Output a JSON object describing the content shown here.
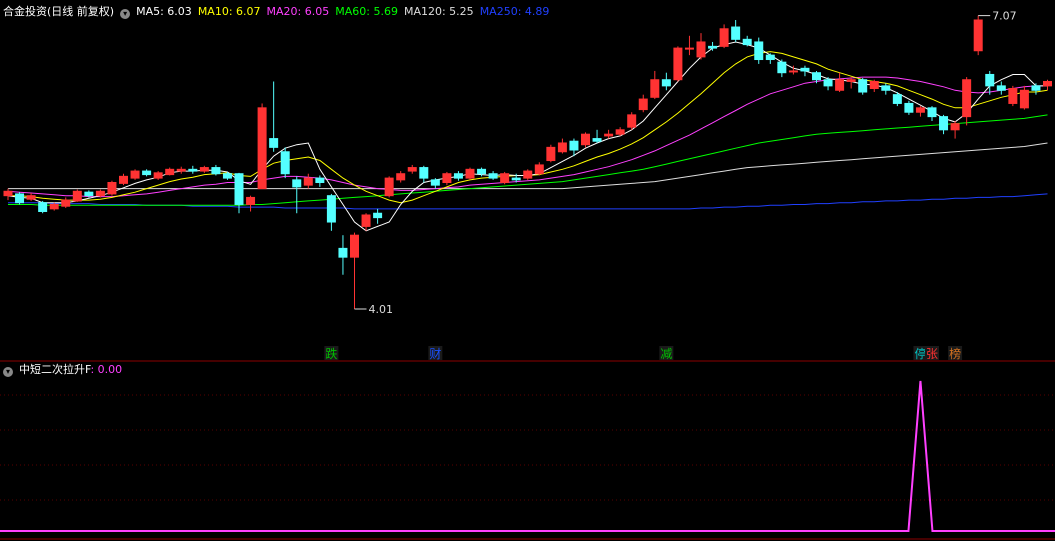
{
  "header": {
    "title": "合金投资(日线 前复权)",
    "ma": [
      {
        "label": "MA5: 6.03",
        "color": "#ffffff"
      },
      {
        "label": "MA10: 6.07",
        "color": "#ffff00"
      },
      {
        "label": "MA20: 6.05",
        "color": "#ff40ff"
      },
      {
        "label": "MA60: 5.69",
        "color": "#00ff00"
      },
      {
        "label": "MA120: 5.25",
        "color": "#dddddd"
      },
      {
        "label": "MA250: 4.89",
        "color": "#2040ff"
      }
    ]
  },
  "indicator": {
    "name": "中短二次拉升F",
    "value": ": 0.00",
    "color": "#ff40ff"
  },
  "colors": {
    "up": "#ff3333",
    "down": "#54ffff",
    "ma5": "#ffffff",
    "ma10": "#ffff00",
    "ma20": "#ff40ff",
    "ma60": "#00ff00",
    "ma120": "#dddddd",
    "ma250": "#2040ff"
  },
  "chart_data": {
    "type": "candlestick",
    "ylim": [
      3.6,
      7.3
    ],
    "candles": [
      [
        5.3,
        5.35,
        5.38,
        5.25
      ],
      [
        5.32,
        5.22,
        5.34,
        5.2
      ],
      [
        5.26,
        5.3,
        5.33,
        5.24
      ],
      [
        5.22,
        5.12,
        5.24,
        5.1
      ],
      [
        5.15,
        5.2,
        5.22,
        5.13
      ],
      [
        5.18,
        5.25,
        5.28,
        5.16
      ],
      [
        5.24,
        5.35,
        5.37,
        5.23
      ],
      [
        5.34,
        5.3,
        5.36,
        5.28
      ],
      [
        5.3,
        5.35,
        5.37,
        5.28
      ],
      [
        5.32,
        5.45,
        5.47,
        5.3
      ],
      [
        5.44,
        5.52,
        5.55,
        5.42
      ],
      [
        5.5,
        5.58,
        5.6,
        5.48
      ],
      [
        5.58,
        5.54,
        5.6,
        5.52
      ],
      [
        5.5,
        5.56,
        5.58,
        5.48
      ],
      [
        5.54,
        5.6,
        5.62,
        5.53
      ],
      [
        5.58,
        5.6,
        5.63,
        5.55
      ],
      [
        5.6,
        5.58,
        5.64,
        5.55
      ],
      [
        5.58,
        5.62,
        5.64,
        5.56
      ],
      [
        5.62,
        5.55,
        5.65,
        5.53
      ],
      [
        5.55,
        5.5,
        5.57,
        5.48
      ],
      [
        5.55,
        5.2,
        5.56,
        5.1
      ],
      [
        5.2,
        5.28,
        5.3,
        5.12
      ],
      [
        5.38,
        6.3,
        6.35,
        5.7
      ],
      [
        5.95,
        5.85,
        6.6,
        5.8
      ],
      [
        5.8,
        5.55,
        5.85,
        5.5
      ],
      [
        5.48,
        5.4,
        5.52,
        5.1
      ],
      [
        5.42,
        5.5,
        5.55,
        5.38
      ],
      [
        5.5,
        5.45,
        5.53,
        5.4
      ],
      [
        5.3,
        5.0,
        5.32,
        4.9
      ],
      [
        4.7,
        4.6,
        4.85,
        4.4
      ],
      [
        4.6,
        4.85,
        4.88,
        4.01
      ],
      [
        4.95,
        5.08,
        5.1,
        4.9
      ],
      [
        5.1,
        5.05,
        5.15,
        4.98
      ],
      [
        5.3,
        5.5,
        5.52,
        5.28
      ],
      [
        5.48,
        5.55,
        5.58,
        5.45
      ],
      [
        5.58,
        5.62,
        5.65,
        5.55
      ],
      [
        5.62,
        5.5,
        5.64,
        5.45
      ],
      [
        5.48,
        5.42,
        5.5,
        5.38
      ],
      [
        5.45,
        5.55,
        5.57,
        5.42
      ],
      [
        5.55,
        5.5,
        5.58,
        5.47
      ],
      [
        5.5,
        5.6,
        5.62,
        5.48
      ],
      [
        5.6,
        5.55,
        5.62,
        5.52
      ],
      [
        5.55,
        5.5,
        5.58,
        5.48
      ],
      [
        5.45,
        5.55,
        5.57,
        5.43
      ],
      [
        5.5,
        5.48,
        5.55,
        5.45
      ],
      [
        5.5,
        5.58,
        5.6,
        5.48
      ],
      [
        5.55,
        5.65,
        5.68,
        5.53
      ],
      [
        5.7,
        5.85,
        5.88,
        5.68
      ],
      [
        5.8,
        5.9,
        5.95,
        5.78
      ],
      [
        5.92,
        5.82,
        5.95,
        5.75
      ],
      [
        5.88,
        6.0,
        6.02,
        5.85
      ],
      [
        5.95,
        5.92,
        6.05,
        5.9
      ],
      [
        5.98,
        6.0,
        6.05,
        5.95
      ],
      [
        6.0,
        6.05,
        6.08,
        5.98
      ],
      [
        6.08,
        6.22,
        6.25,
        6.05
      ],
      [
        6.28,
        6.4,
        6.45,
        6.25
      ],
      [
        6.42,
        6.62,
        6.72,
        6.4
      ],
      [
        6.62,
        6.55,
        6.7,
        6.5
      ],
      [
        6.62,
        6.98,
        7.0,
        6.6
      ],
      [
        6.98,
        6.98,
        7.12,
        6.9
      ],
      [
        6.88,
        7.05,
        7.15,
        6.85
      ],
      [
        7.0,
        6.98,
        7.05,
        6.95
      ],
      [
        7.0,
        7.2,
        7.25,
        6.98
      ],
      [
        7.22,
        7.08,
        7.3,
        7.05
      ],
      [
        7.08,
        7.02,
        7.12,
        7.0
      ],
      [
        7.05,
        6.85,
        7.1,
        6.8
      ],
      [
        6.9,
        6.85,
        6.92,
        6.8
      ],
      [
        6.82,
        6.7,
        6.85,
        6.65
      ],
      [
        6.72,
        6.72,
        6.78,
        6.68
      ],
      [
        6.75,
        6.72,
        6.78,
        6.66
      ],
      [
        6.7,
        6.62,
        6.72,
        6.58
      ],
      [
        6.62,
        6.55,
        6.65,
        6.5
      ],
      [
        6.5,
        6.62,
        6.7,
        6.48
      ],
      [
        6.6,
        6.62,
        6.65,
        6.52
      ],
      [
        6.62,
        6.48,
        6.64,
        6.45
      ],
      [
        6.52,
        6.6,
        6.62,
        6.48
      ],
      [
        6.55,
        6.5,
        6.58,
        6.45
      ],
      [
        6.45,
        6.35,
        6.48,
        6.32
      ],
      [
        6.35,
        6.25,
        6.38,
        6.22
      ],
      [
        6.25,
        6.3,
        6.32,
        6.2
      ],
      [
        6.3,
        6.2,
        6.32,
        6.15
      ],
      [
        6.2,
        6.05,
        6.22,
        6.0
      ],
      [
        6.05,
        6.12,
        6.15,
        5.95
      ],
      [
        6.2,
        6.62,
        6.65,
        6.1
      ],
      [
        6.95,
        7.3,
        7.35,
        6.9
      ],
      [
        6.68,
        6.55,
        6.72,
        6.45
      ],
      [
        6.55,
        6.5,
        6.6,
        6.45
      ],
      [
        6.35,
        6.52,
        6.55,
        6.32
      ],
      [
        6.3,
        6.5,
        6.55,
        6.28
      ],
      [
        6.55,
        6.5,
        6.58,
        6.45
      ],
      [
        6.55,
        6.6,
        6.62,
        6.5
      ]
    ],
    "ma5": [
      5.3,
      5.28,
      5.27,
      5.22,
      5.22,
      5.22,
      5.24,
      5.27,
      5.3,
      5.34,
      5.39,
      5.44,
      5.48,
      5.51,
      5.56,
      5.58,
      5.58,
      5.59,
      5.59,
      5.57,
      5.47,
      5.43,
      5.6,
      5.75,
      5.84,
      5.88,
      5.9,
      5.6,
      5.4,
      5.2,
      5.0,
      4.9,
      4.95,
      5.0,
      5.2,
      5.35,
      5.45,
      5.48,
      5.5,
      5.52,
      5.55,
      5.54,
      5.53,
      5.54,
      5.53,
      5.53,
      5.55,
      5.62,
      5.69,
      5.76,
      5.84,
      5.9,
      5.95,
      5.98,
      6.05,
      6.15,
      6.3,
      6.45,
      6.6,
      6.75,
      6.88,
      6.98,
      7.02,
      7.05,
      7.02,
      6.98,
      6.9,
      6.82,
      6.75,
      6.72,
      6.68,
      6.63,
      6.62,
      6.6,
      6.57,
      6.56,
      6.53,
      6.47,
      6.4,
      6.33,
      6.26,
      6.18,
      6.14,
      6.24,
      6.4,
      6.55,
      6.62,
      6.68,
      6.68,
      6.55,
      6.55
    ],
    "ma10": [
      5.3,
      5.3,
      5.29,
      5.27,
      5.26,
      5.25,
      5.25,
      5.25,
      5.26,
      5.28,
      5.31,
      5.34,
      5.38,
      5.42,
      5.46,
      5.49,
      5.51,
      5.54,
      5.55,
      5.56,
      5.53,
      5.52,
      5.6,
      5.67,
      5.7,
      5.72,
      5.74,
      5.7,
      5.6,
      5.5,
      5.42,
      5.35,
      5.3,
      5.25,
      5.22,
      5.25,
      5.3,
      5.35,
      5.4,
      5.45,
      5.48,
      5.5,
      5.51,
      5.52,
      5.53,
      5.53,
      5.54,
      5.57,
      5.6,
      5.64,
      5.69,
      5.74,
      5.78,
      5.83,
      5.89,
      5.96,
      6.05,
      6.14,
      6.24,
      6.35,
      6.46,
      6.58,
      6.7,
      6.8,
      6.88,
      6.92,
      6.94,
      6.92,
      6.88,
      6.84,
      6.8,
      6.74,
      6.7,
      6.66,
      6.62,
      6.6,
      6.58,
      6.55,
      6.5,
      6.45,
      6.4,
      6.34,
      6.3,
      6.3,
      6.34,
      6.38,
      6.42,
      6.45,
      6.48,
      6.48,
      6.5
    ],
    "ma20": [
      5.35,
      5.34,
      5.33,
      5.32,
      5.31,
      5.3,
      5.3,
      5.29,
      5.29,
      5.29,
      5.3,
      5.31,
      5.32,
      5.34,
      5.36,
      5.38,
      5.4,
      5.42,
      5.43,
      5.45,
      5.45,
      5.45,
      5.48,
      5.5,
      5.52,
      5.52,
      5.51,
      5.5,
      5.48,
      5.45,
      5.42,
      5.4,
      5.38,
      5.37,
      5.36,
      5.36,
      5.37,
      5.38,
      5.39,
      5.4,
      5.42,
      5.43,
      5.44,
      5.45,
      5.46,
      5.47,
      5.48,
      5.5,
      5.52,
      5.54,
      5.57,
      5.6,
      5.63,
      5.67,
      5.71,
      5.76,
      5.81,
      5.87,
      5.93,
      5.99,
      6.06,
      6.13,
      6.2,
      6.27,
      6.34,
      6.4,
      6.46,
      6.5,
      6.54,
      6.58,
      6.6,
      6.62,
      6.63,
      6.64,
      6.65,
      6.65,
      6.65,
      6.64,
      6.62,
      6.6,
      6.57,
      6.54,
      6.5,
      6.48,
      6.47,
      6.48,
      6.5,
      6.52,
      6.54,
      6.55,
      6.55
    ],
    "ma60": [
      5.2,
      5.2,
      5.2,
      5.19,
      5.19,
      5.19,
      5.19,
      5.19,
      5.19,
      5.19,
      5.19,
      5.19,
      5.19,
      5.19,
      5.19,
      5.19,
      5.19,
      5.19,
      5.19,
      5.19,
      5.19,
      5.2,
      5.2,
      5.21,
      5.22,
      5.23,
      5.24,
      5.25,
      5.26,
      5.27,
      5.28,
      5.29,
      5.3,
      5.31,
      5.32,
      5.33,
      5.34,
      5.35,
      5.36,
      5.37,
      5.38,
      5.39,
      5.4,
      5.41,
      5.42,
      5.43,
      5.44,
      5.45,
      5.46,
      5.48,
      5.5,
      5.52,
      5.54,
      5.56,
      5.58,
      5.6,
      5.63,
      5.66,
      5.69,
      5.72,
      5.75,
      5.78,
      5.81,
      5.84,
      5.87,
      5.9,
      5.92,
      5.94,
      5.96,
      5.98,
      6.0,
      6.01,
      6.02,
      6.03,
      6.04,
      6.05,
      6.06,
      6.07,
      6.08,
      6.09,
      6.1,
      6.11,
      6.12,
      6.13,
      6.14,
      6.15,
      6.16,
      6.17,
      6.18,
      6.2,
      6.22
    ],
    "ma120": [
      5.38,
      5.38,
      5.38,
      5.38,
      5.38,
      5.38,
      5.38,
      5.38,
      5.38,
      5.38,
      5.38,
      5.38,
      5.38,
      5.38,
      5.38,
      5.38,
      5.38,
      5.38,
      5.38,
      5.38,
      5.38,
      5.38,
      5.38,
      5.38,
      5.38,
      5.38,
      5.38,
      5.38,
      5.38,
      5.38,
      5.38,
      5.38,
      5.38,
      5.38,
      5.38,
      5.38,
      5.38,
      5.38,
      5.38,
      5.38,
      5.38,
      5.38,
      5.38,
      5.38,
      5.38,
      5.38,
      5.38,
      5.38,
      5.38,
      5.39,
      5.4,
      5.41,
      5.42,
      5.43,
      5.44,
      5.45,
      5.46,
      5.48,
      5.5,
      5.52,
      5.54,
      5.56,
      5.58,
      5.6,
      5.62,
      5.63,
      5.64,
      5.65,
      5.66,
      5.67,
      5.68,
      5.69,
      5.7,
      5.71,
      5.72,
      5.73,
      5.74,
      5.75,
      5.76,
      5.77,
      5.78,
      5.79,
      5.8,
      5.81,
      5.82,
      5.83,
      5.84,
      5.85,
      5.86,
      5.88,
      5.9
    ],
    "ma250": [
      5.22,
      5.22,
      5.22,
      5.22,
      5.21,
      5.21,
      5.21,
      5.21,
      5.2,
      5.2,
      5.2,
      5.2,
      5.19,
      5.19,
      5.19,
      5.19,
      5.18,
      5.18,
      5.18,
      5.18,
      5.17,
      5.17,
      5.17,
      5.17,
      5.16,
      5.16,
      5.16,
      5.16,
      5.16,
      5.16,
      5.15,
      5.15,
      5.15,
      5.15,
      5.15,
      5.15,
      5.15,
      5.15,
      5.15,
      5.15,
      5.15,
      5.15,
      5.15,
      5.15,
      5.15,
      5.15,
      5.15,
      5.15,
      5.15,
      5.15,
      5.15,
      5.15,
      5.15,
      5.15,
      5.15,
      5.15,
      5.15,
      5.15,
      5.15,
      5.15,
      5.16,
      5.16,
      5.17,
      5.17,
      5.18,
      5.18,
      5.19,
      5.19,
      5.2,
      5.2,
      5.21,
      5.21,
      5.22,
      5.22,
      5.23,
      5.23,
      5.24,
      5.24,
      5.25,
      5.25,
      5.26,
      5.26,
      5.27,
      5.27,
      5.28,
      5.28,
      5.29,
      5.29,
      5.3,
      5.31,
      5.32
    ],
    "annotations": [
      {
        "label": "7.07",
        "index": 84
      },
      {
        "label": "4.01",
        "index": 30
      }
    ],
    "event_tags": [
      {
        "label": "跌",
        "index": 28,
        "color": "#00c000"
      },
      {
        "label": "财",
        "index": 37,
        "color": "#1a50ff"
      },
      {
        "label": "减",
        "index": 57,
        "color": "#00c000"
      },
      {
        "label": "停",
        "index": 79,
        "color": "#00c0c0"
      },
      {
        "label": "张",
        "index": 80,
        "color": "#ff3030"
      },
      {
        "label": "榜",
        "index": 82,
        "color": "#d07020"
      }
    ],
    "indicator_series": {
      "name": "中短二次拉升F",
      "spike_index": 79,
      "values_note": "0 except spike"
    },
    "indicator_ylim": [
      0,
      1
    ]
  }
}
